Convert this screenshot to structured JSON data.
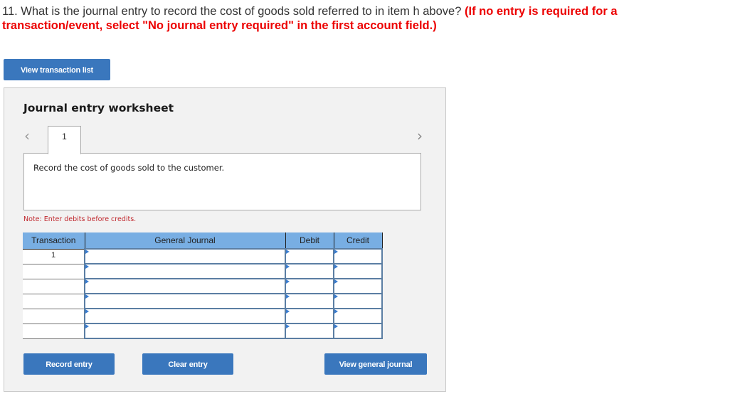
{
  "question": {
    "number_text": "11. What is the journal entry to record the cost of goods sold referred to in item h above?",
    "instruction": "(If no entry is required for a transaction/event, select \"No journal entry required\" in the first account field.)"
  },
  "toolbar": {
    "view_transaction_list_label": "View transaction list"
  },
  "worksheet": {
    "title": "Journal entry worksheet",
    "nav_prev_glyph": "‹",
    "nav_next_glyph": "›",
    "active_tab": "1",
    "description": "Record the cost of goods sold to the customer.",
    "note": "Note: Enter debits before credits.",
    "table": {
      "headers": [
        "Transaction",
        "General Journal",
        "Debit",
        "Credit"
      ],
      "rows": [
        {
          "transaction": "1",
          "account": "",
          "debit": "",
          "credit": ""
        },
        {
          "transaction": "",
          "account": "",
          "debit": "",
          "credit": ""
        },
        {
          "transaction": "",
          "account": "",
          "debit": "",
          "credit": ""
        },
        {
          "transaction": "",
          "account": "",
          "debit": "",
          "credit": ""
        },
        {
          "transaction": "",
          "account": "",
          "debit": "",
          "credit": ""
        },
        {
          "transaction": "",
          "account": "",
          "debit": "",
          "credit": ""
        }
      ]
    },
    "buttons": {
      "record_entry": "Record entry",
      "clear_entry": "Clear entry",
      "view_general_journal": "View general journal"
    }
  },
  "colors": {
    "accent_button": "#3a77bd",
    "instruction_red": "#ec0000",
    "note_red": "#c0272d",
    "table_header": "#78aee3",
    "cell_border": "#5b7ea3"
  }
}
